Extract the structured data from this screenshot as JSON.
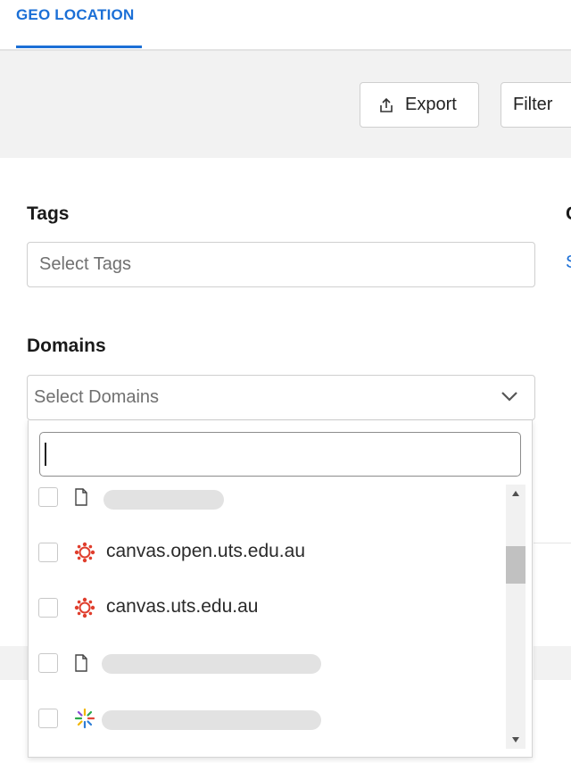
{
  "tabs": {
    "active_label": "GEO LOCATION"
  },
  "toolbar": {
    "export_label": "Export",
    "filter_label": "Filter"
  },
  "tags": {
    "label": "Tags",
    "placeholder": "Select Tags"
  },
  "right_column": {
    "label": "C",
    "link": "S"
  },
  "domains": {
    "label": "Domains",
    "placeholder": "Select Domains",
    "search_value": "",
    "items": [
      {
        "label": "",
        "icon": "document-icon",
        "checked": false,
        "redacted": true
      },
      {
        "label": "canvas.open.uts.edu.au",
        "icon": "canvas-icon",
        "checked": false,
        "redacted": false
      },
      {
        "label": "canvas.uts.edu.au",
        "icon": "canvas-icon",
        "checked": false,
        "redacted": false
      },
      {
        "label": "",
        "icon": "document-icon",
        "checked": false,
        "redacted": true
      },
      {
        "label": "",
        "icon": "sparkle-icon",
        "checked": false,
        "redacted": true
      }
    ]
  },
  "colors": {
    "accent": "#1b6fd6",
    "canvas_red": "#e03e2d"
  }
}
